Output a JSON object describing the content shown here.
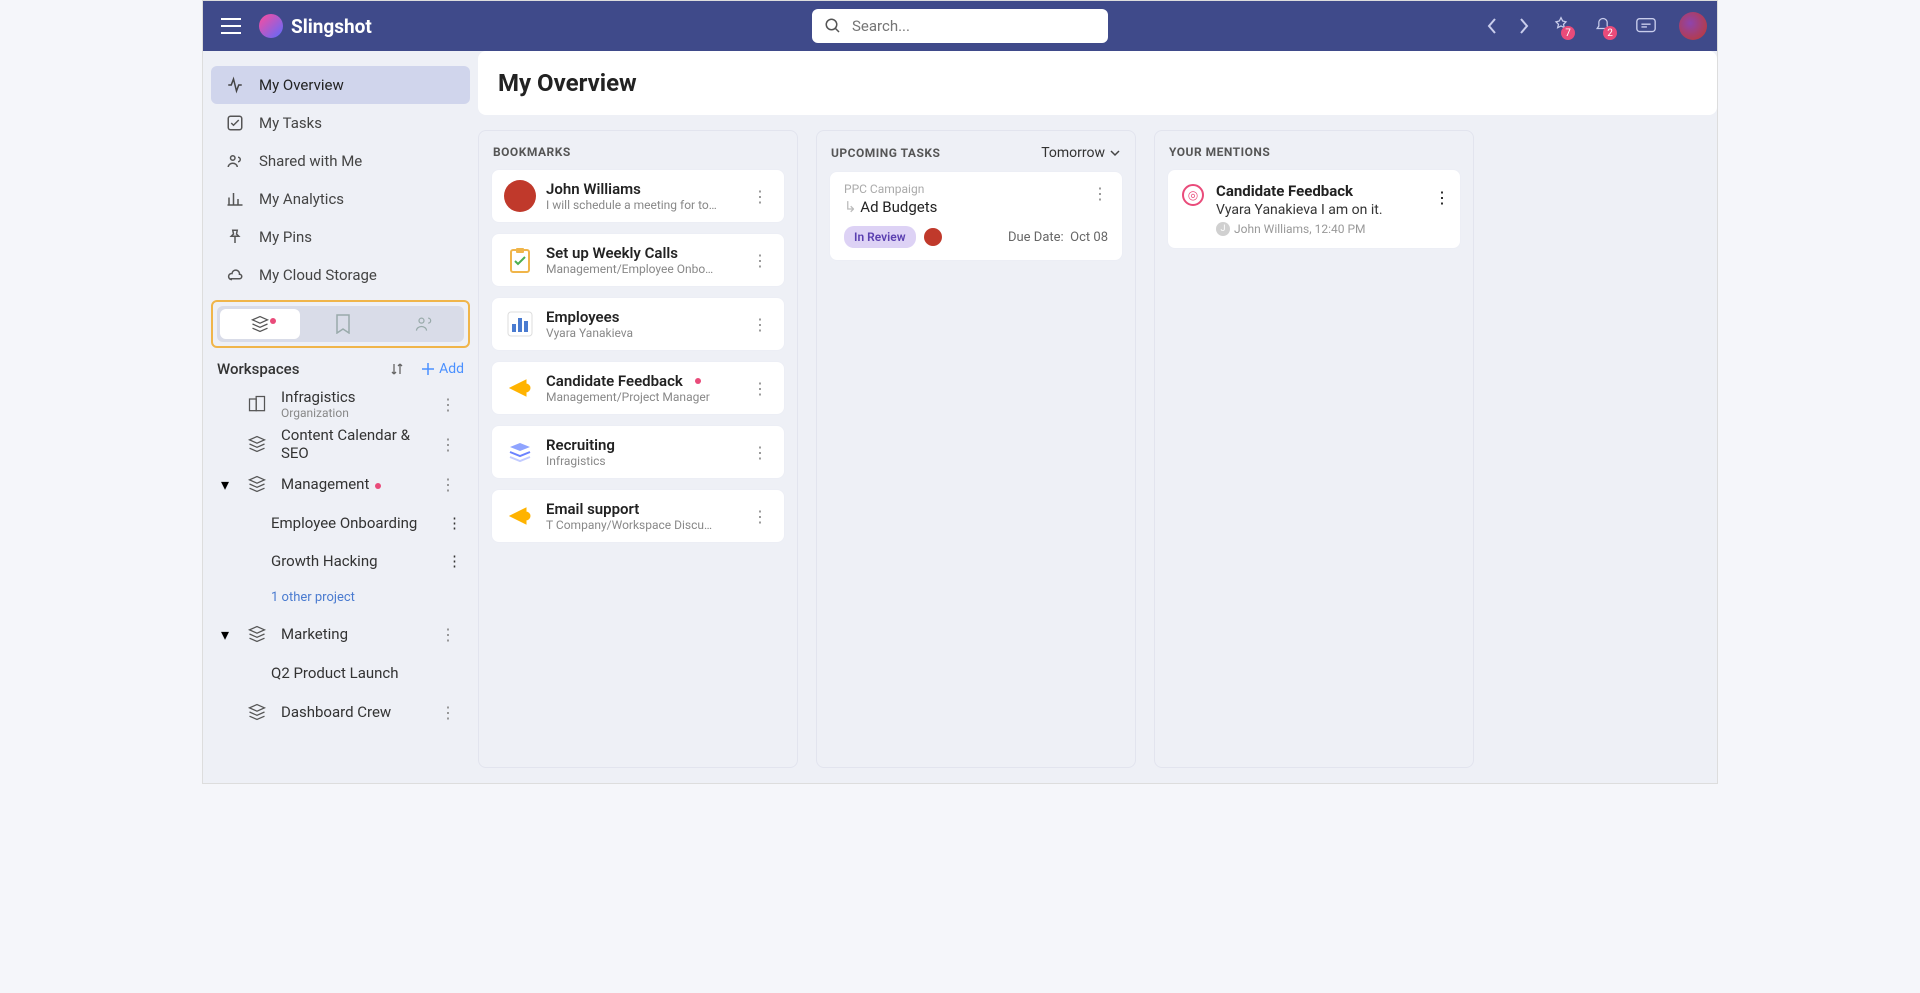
{
  "brand": "Slingshot",
  "search_placeholder": "Search...",
  "badges": {
    "announcements": "7",
    "notifications": "2"
  },
  "sidebar": {
    "nav": [
      {
        "label": "My Overview",
        "active": true
      },
      {
        "label": "My Tasks"
      },
      {
        "label": "Shared with Me"
      },
      {
        "label": "My Analytics"
      },
      {
        "label": "My Pins"
      },
      {
        "label": "My Cloud Storage"
      }
    ],
    "workspaces_label": "Workspaces",
    "add_label": "Add",
    "items": [
      {
        "label": "Infragistics",
        "sub": "Organization"
      },
      {
        "label": "Content Calendar & SEO"
      },
      {
        "label": "Management",
        "dot": true,
        "expanded": true,
        "children": [
          "Employee Onboarding",
          "Growth Hacking"
        ],
        "other": "1 other project"
      },
      {
        "label": "Marketing",
        "expanded": true,
        "children": [
          "Q2 Product Launch"
        ]
      },
      {
        "label": "Dashboard Crew"
      }
    ]
  },
  "page_title": "My Overview",
  "bookmarks_title": "BOOKMARKS",
  "bookmarks": [
    {
      "title": "John Williams",
      "sub": "I will schedule a meeting for to…",
      "icon": "avatar"
    },
    {
      "title": "Set up Weekly Calls",
      "sub": "Management/Employee Onbo…",
      "icon": "clipboard"
    },
    {
      "title": "Employees",
      "sub": "Vyara Yanakieva",
      "icon": "barchart"
    },
    {
      "title": "Candidate Feedback",
      "sub": "Management/Project Manager",
      "icon": "megaphone",
      "dot": true
    },
    {
      "title": "Recruiting",
      "sub": "Infragistics",
      "icon": "stack"
    },
    {
      "title": "Email support",
      "sub": "T Company/Workspace Discu…",
      "icon": "megaphone"
    }
  ],
  "upcoming_title": "UPCOMING TASKS",
  "upcoming_filter": "Tomorrow",
  "upcoming": {
    "parent": "PPC Campaign",
    "subarrow": "↳ ",
    "name": "Ad Budgets",
    "chip": "In Review",
    "due_label": "Due Date:",
    "due_value": "Oct 08"
  },
  "mentions_title": "YOUR MENTIONS",
  "mention": {
    "title": "Candidate Feedback",
    "text": "Vyara Yanakieva I am on it.",
    "meta_initial": "J",
    "meta": "John Williams, 12:40 PM"
  }
}
